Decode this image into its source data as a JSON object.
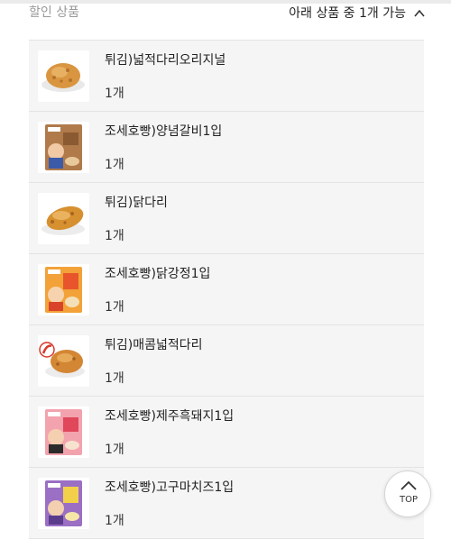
{
  "header": {
    "title": "할인 상품",
    "selector_label": "아래 상품 중 1개 가능"
  },
  "items": [
    {
      "name": "튀김)넓적다리오리지널",
      "qty": "1개",
      "thumb": "fried-chicken"
    },
    {
      "name": "조세호빵)양념갈비1입",
      "qty": "1개",
      "thumb": "bread-package"
    },
    {
      "name": "튀김)닭다리",
      "qty": "1개",
      "thumb": "fried-chicken"
    },
    {
      "name": "조세호빵)닭강정1입",
      "qty": "1개",
      "thumb": "bread-package"
    },
    {
      "name": "튀김)매콤넓적다리",
      "qty": "1개",
      "thumb": "spicy-fried-chicken"
    },
    {
      "name": "조세호빵)제주흑돼지1입",
      "qty": "1개",
      "thumb": "bread-package"
    },
    {
      "name": "조세호빵)고구마치즈1입",
      "qty": "1개",
      "thumb": "bread-package"
    }
  ],
  "top_button": {
    "label": "TOP"
  },
  "colors": {
    "pkg_1": "#b07a4a",
    "pkg_2": "#f2a238",
    "pkg_3": "#f2a3ae",
    "pkg_4": "#9a6fc4"
  }
}
